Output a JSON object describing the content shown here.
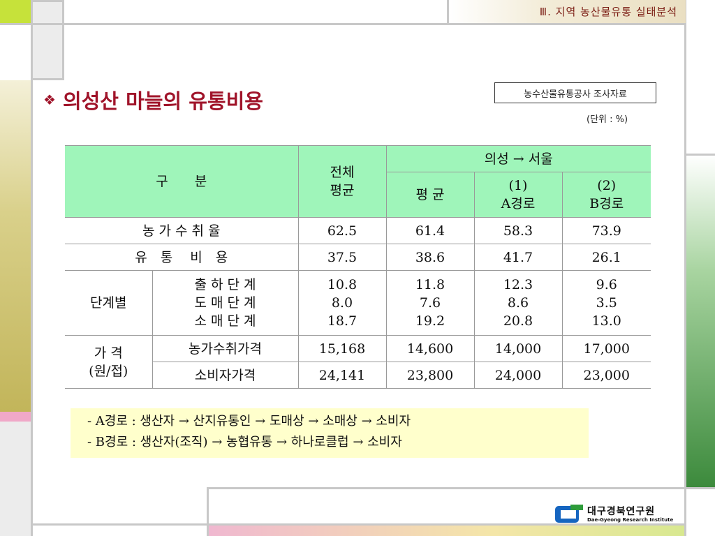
{
  "header": {
    "section_title": "Ⅲ. 지역 농산물유통 실태분석"
  },
  "title": {
    "bullet_icon": "diamond-bullet-icon",
    "text": "의성산 마늘의 유통비용"
  },
  "source_note": "농수산물유통공사 조사자료",
  "unit_note": "(단위 : %)",
  "table": {
    "header": {
      "category": "구　　분",
      "total_l1": "전체",
      "total_l2": "평균",
      "group": "의성 → 서울",
      "avg": "평 균",
      "route_a_l1": "(1)",
      "route_a_l2": "A경로",
      "route_b_l1": "(2)",
      "route_b_l2": "B경로"
    },
    "rows": {
      "farm_share": {
        "label": "농 가 수 취 율",
        "total": "62.5",
        "avg": "61.4",
        "a": "58.3",
        "b": "73.9"
      },
      "dist_cost": {
        "label": "유　통　 비　용",
        "total": "37.5",
        "avg": "38.6",
        "a": "41.7",
        "b": "26.1"
      },
      "stage": {
        "group_label": "단계별",
        "shipping": {
          "label": "출 하 단 계",
          "total": "10.8",
          "avg": "11.8",
          "a": "12.3",
          "b": "9.6"
        },
        "wholesale": {
          "label": "도 매 단 계",
          "total": "8.0",
          "avg": "7.6",
          "a": "8.6",
          "b": "3.5"
        },
        "retail": {
          "label": "소 매 단 계",
          "total": "18.7",
          "avg": "19.2",
          "a": "20.8",
          "b": "13.0"
        }
      },
      "price": {
        "group_l1": "가 격",
        "group_l2": "(원/접)",
        "farm": {
          "label": "농가수취가격",
          "total": "15,168",
          "avg": "14,600",
          "a": "14,000",
          "b": "17,000"
        },
        "consumer": {
          "label": "소비자가격",
          "total": "24,141",
          "avg": "23,800",
          "a": "24,000",
          "b": "23,000"
        }
      }
    }
  },
  "routes": {
    "a": "- A경로 : 생산자 → 산지유통인 → 도매상 → 소매상 → 소비자",
    "b": "- B경로 : 생산자(조직) → 농협유통 → 하나로클럽 → 소비자"
  },
  "logo": {
    "icon": "institute-logo-icon",
    "name_ko": "대구경북연구원",
    "name_en": "Dae-Gyeong Research Institute"
  },
  "colors": {
    "table_header_bg": "#9ff5ba",
    "title_color": "#a0142a",
    "route_box_bg": "#ffffcc",
    "left_bar_olive": "#c9bf6e",
    "right_bar_green": "#3c8a3c",
    "left_bar_pink": "#f0a8c8"
  }
}
